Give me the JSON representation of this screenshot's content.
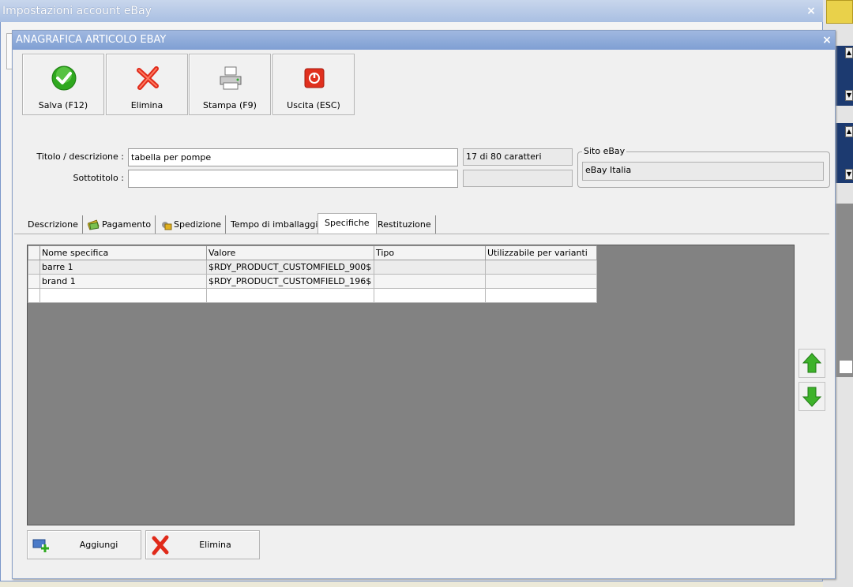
{
  "background_window": {
    "title": "Impostazioni account eBay",
    "close": "×"
  },
  "dialog": {
    "title": "ANAGRAFICA ARTICOLO EBAY",
    "close": "×"
  },
  "toolbar": {
    "save": "Salva (F12)",
    "delete": "Elimina",
    "print": "Stampa (F9)",
    "exit": "Uscita (ESC)"
  },
  "form": {
    "title_label": "Titolo / descrizione :",
    "title_value": "tabella per pompe",
    "char_count": "17 di 80 caratteri",
    "subtitle_label": "Sottotitolo :",
    "subtitle_value": "",
    "subtitle_count": ""
  },
  "site": {
    "legend": "Sito eBay",
    "value": "eBay Italia"
  },
  "tabs": [
    "Descrizione",
    "Pagamento",
    "Spedizione",
    "Tempo di imballaggio",
    "Specifiche",
    "Restituzione"
  ],
  "active_tab": "Specifiche",
  "table": {
    "headers": [
      "Nome specifica",
      "Valore",
      "Tipo",
      "Utilizzabile per varianti"
    ],
    "rows": [
      [
        "barre 1",
        "$RDY_PRODUCT_CUSTOMFIELD_900$",
        "",
        ""
      ],
      [
        "brand 1",
        "$RDY_PRODUCT_CUSTOMFIELD_196$",
        "",
        ""
      ],
      [
        "",
        "",
        "",
        ""
      ]
    ]
  },
  "bottom": {
    "add": "Aggiungi",
    "delete": "Elimina"
  },
  "colors": {
    "title_bar": "#7f9fd3",
    "grid_bg": "#828282",
    "green_arrow": "#3db22a"
  }
}
